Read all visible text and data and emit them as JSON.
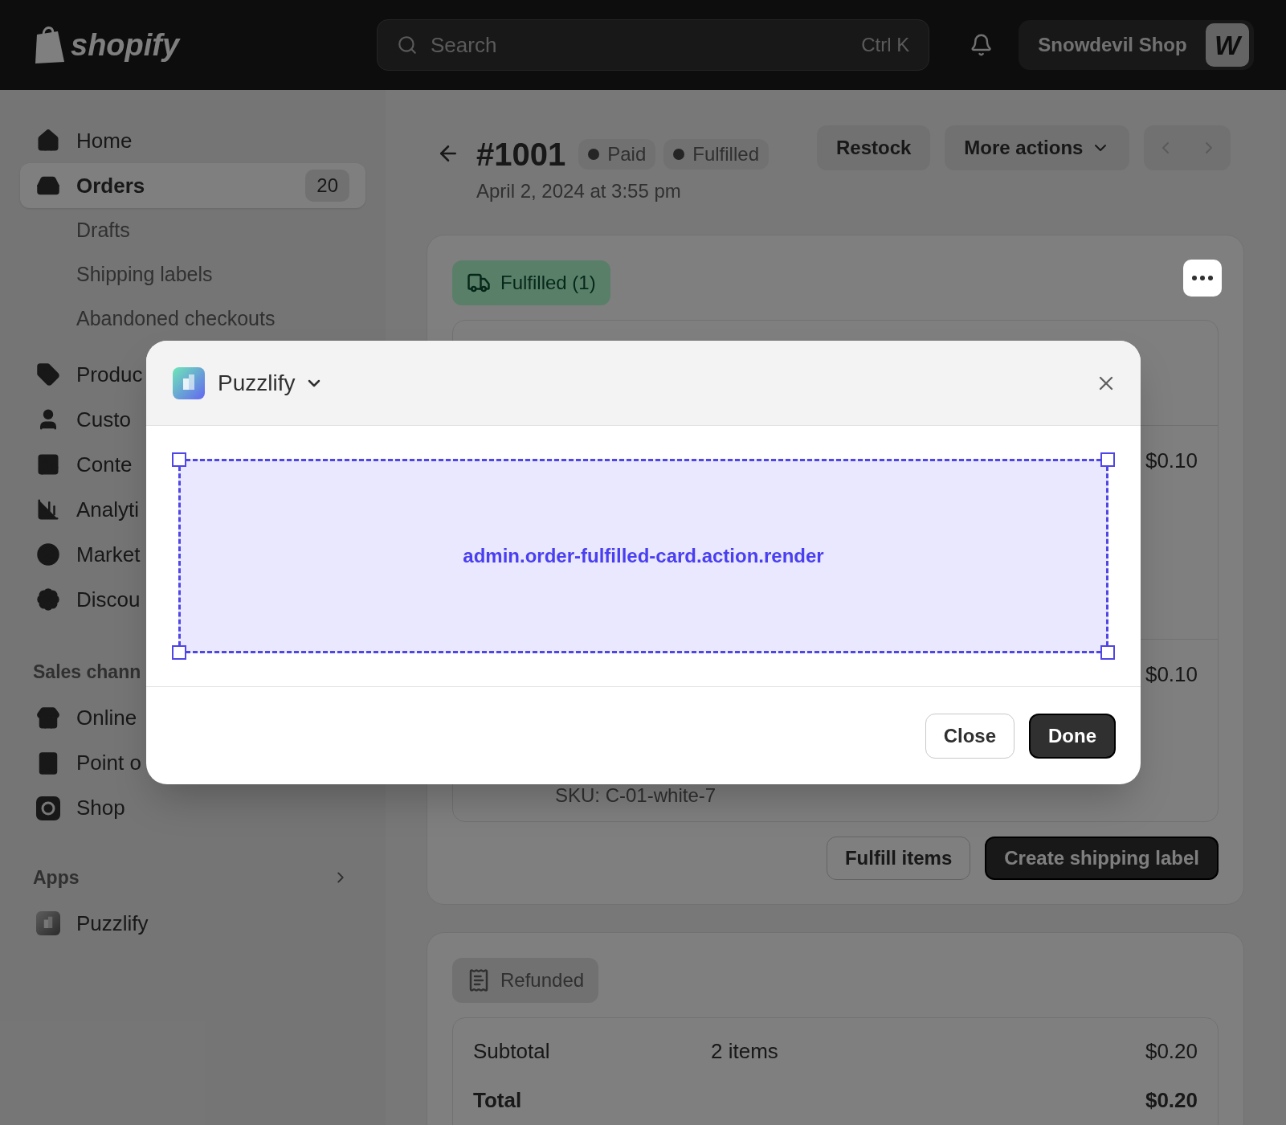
{
  "top_bar": {
    "logo": "shopify",
    "search": {
      "placeholder": "Search",
      "shortcut": "Ctrl K"
    },
    "store": {
      "name": "Snowdevil Shop",
      "avatar": "W"
    }
  },
  "sidebar": {
    "items": [
      {
        "label": "Home",
        "selected": false
      },
      {
        "label": "Orders",
        "selected": true,
        "badge": "20",
        "children": [
          {
            "label": "Drafts",
            "selected": false
          },
          {
            "label": "Shipping labels",
            "selected": false
          },
          {
            "label": "Abandoned checkouts",
            "selected": false
          }
        ]
      },
      {
        "label": "Produc",
        "selected": false
      },
      {
        "label": "Custo",
        "selected": false
      },
      {
        "label": "Conte",
        "selected": false
      },
      {
        "label": "Analyti",
        "selected": false
      },
      {
        "label": "Market",
        "selected": false
      },
      {
        "label": "Discou",
        "selected": false
      }
    ],
    "sales_channels": {
      "title": "Sales chann",
      "items": [
        {
          "label": "Online",
          "selected": false
        },
        {
          "label": "Point o",
          "selected": false
        },
        {
          "label": "Shop",
          "selected": false
        }
      ]
    },
    "apps": {
      "title": "Apps",
      "items": [
        {
          "label": "Puzzlify",
          "selected": false
        }
      ]
    }
  },
  "order": {
    "title": "#1001",
    "badges": [
      "Paid",
      "Fulfilled"
    ],
    "date": "April 2, 2024 at 3:55 pm",
    "actions": [
      "Restock",
      "More actions"
    ]
  },
  "fulfillment_card": {
    "badge": "Fulfilled (1)",
    "line_items": [
      {
        "price": "$0.10"
      },
      {
        "price": "$0.10",
        "sku": "SKU: C-01-white-7"
      }
    ],
    "buttons": [
      "Fulfill items",
      "Create shipping label"
    ]
  },
  "payment_card": {
    "badge": "Refunded",
    "rows": [
      {
        "kind": "line",
        "label": "Subtotal",
        "detail": "2 items",
        "amount": "$0.20"
      },
      {
        "kind": "total",
        "label": "Total",
        "amount": "$0.20"
      }
    ]
  },
  "modal": {
    "app": "Puzzlify",
    "target": "admin.order-fulfilled-card.action.render",
    "buttons": [
      "Close",
      "Done"
    ]
  }
}
